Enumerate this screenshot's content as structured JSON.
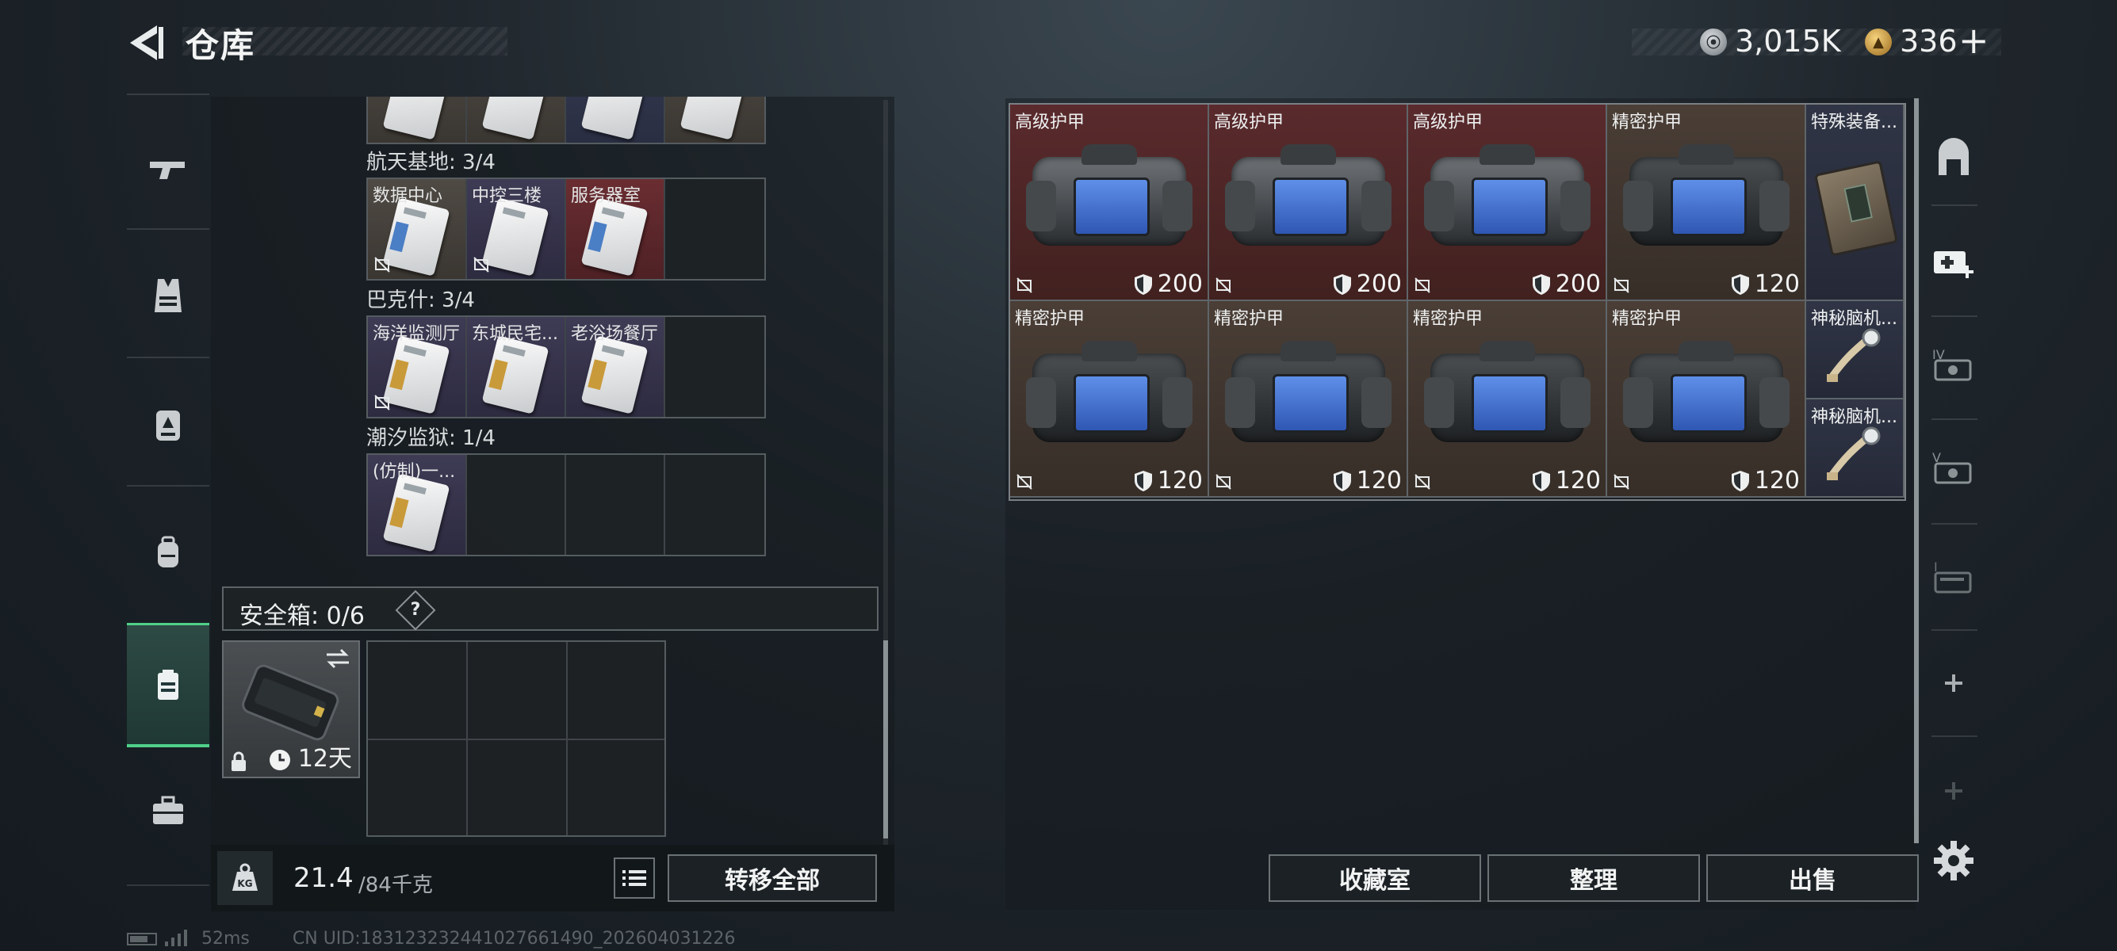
{
  "header": {
    "title": "仓库",
    "currency_a": "3,015K",
    "currency_a_icon": "silver-coin-icon",
    "currency_b": "336",
    "currency_b_icon": "gold-coin-icon",
    "add_symbol": "+"
  },
  "left_nav": {
    "items": [
      "gun-icon",
      "vest-icon",
      "backpack-armor-icon",
      "backpack-icon",
      "container-icon",
      "toolbox-icon"
    ],
    "active": "container-icon"
  },
  "storage": {
    "groups": [
      {
        "title": "航天基地: 3/4",
        "cards": [
          {
            "name": "数据中心",
            "color": "gray"
          },
          {
            "name": "中控三楼",
            "color": "purple"
          },
          {
            "name": "服务器室",
            "color": "red"
          },
          {
            "name": "",
            "color": "empty"
          }
        ]
      },
      {
        "title": "巴克什: 3/4",
        "cards": [
          {
            "name": "海洋监测厅",
            "color": "purple"
          },
          {
            "name": "东城民宅...",
            "color": "purple"
          },
          {
            "name": "老浴场餐厅",
            "color": "purple"
          },
          {
            "name": "",
            "color": "empty"
          }
        ]
      },
      {
        "title": "潮汐监狱: 1/4",
        "cards": [
          {
            "name": "(仿制)一...",
            "color": "purple"
          },
          {
            "name": "",
            "color": "empty"
          },
          {
            "name": "",
            "color": "empty"
          },
          {
            "name": "",
            "color": "empty"
          }
        ]
      }
    ],
    "safe_box": {
      "title": "安全箱: 0/6",
      "help": "?",
      "days": "12天"
    },
    "weight": {
      "current": "21.4",
      "max": "/84千克",
      "icon": "KG"
    },
    "transfer_all": "转移全部"
  },
  "inventory": {
    "items": [
      {
        "name": "高级护甲",
        "durability": "200",
        "quality": "red",
        "type": "armor"
      },
      {
        "name": "高级护甲",
        "durability": "200",
        "quality": "red",
        "type": "armor"
      },
      {
        "name": "高级护甲",
        "durability": "200",
        "quality": "red",
        "type": "armor"
      },
      {
        "name": "精密护甲",
        "durability": "120",
        "quality": "brown",
        "type": "armor"
      },
      {
        "name": "特殊装备...",
        "durability": "",
        "quality": "blue",
        "type": "case"
      },
      {
        "name": "精密护甲",
        "durability": "120",
        "quality": "brown",
        "type": "armor"
      },
      {
        "name": "精密护甲",
        "durability": "120",
        "quality": "brown",
        "type": "armor"
      },
      {
        "name": "精密护甲",
        "durability": "120",
        "quality": "brown",
        "type": "armor"
      },
      {
        "name": "精密护甲",
        "durability": "120",
        "quality": "brown",
        "type": "armor"
      },
      {
        "name": "神秘脑机...",
        "durability": "",
        "quality": "blue",
        "type": "implant"
      },
      {
        "name": "神秘脑机...",
        "durability": "",
        "quality": "blue",
        "type": "implant"
      }
    ],
    "buttons": {
      "collection": "收藏室",
      "sort": "整理",
      "sell": "出售"
    }
  },
  "right_nav": {
    "items": [
      "armor-rack-icon",
      "medkit-add-icon",
      "crate-iv-icon",
      "crate-v-icon",
      "crate-i-icon",
      "plus-icon",
      "plus-icon-disabled",
      "settings-gear-icon"
    ]
  },
  "status": {
    "ping": "52ms",
    "uid": "CN UID:18312323244102766149​0_202604031226"
  }
}
